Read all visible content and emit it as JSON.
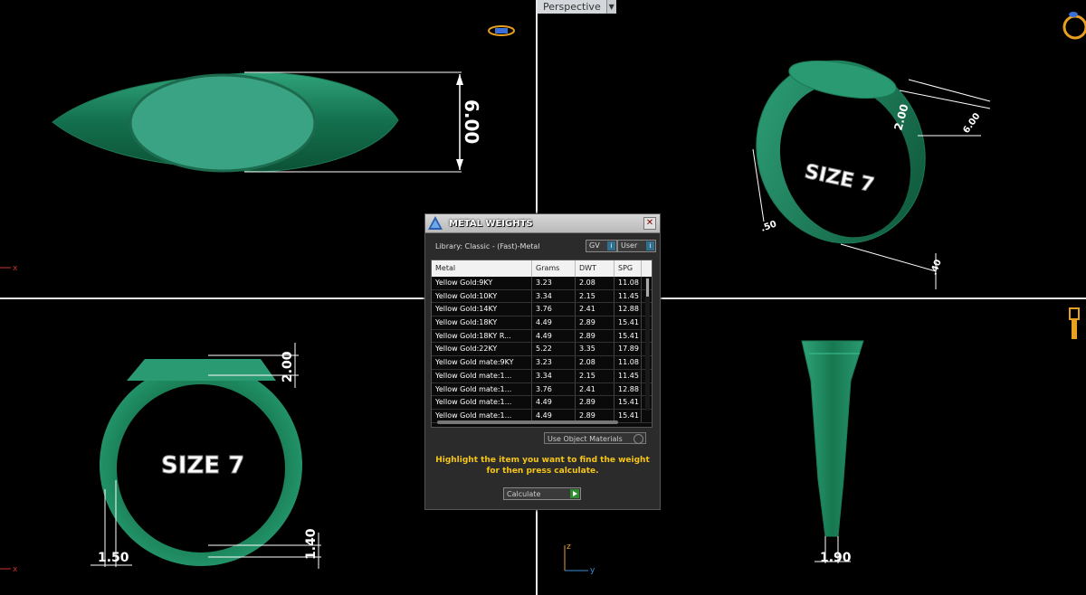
{
  "viewport": {
    "perspective_label": "Perspective",
    "top_left": {
      "dimension": "6.00"
    },
    "top_right": {
      "dim_a": "2.00",
      "dim_b": "6.00",
      "dim_c": ".50",
      "dim_d": ".40",
      "size_text": "SIZE 7"
    },
    "bottom_left": {
      "dim_top": "2.00",
      "dim_bottom": "1.40",
      "dim_left": "1.50",
      "size_text": "SIZE 7"
    },
    "bottom_right": {
      "dimension": "1.90"
    },
    "axis": {
      "x": "x",
      "y": "y",
      "z": "z"
    }
  },
  "dialog": {
    "title": "METAL WEIGHTS",
    "close_label": "✕",
    "library_label": "Library: Classic - (Fast)-Metal",
    "toggle_gv": "GV",
    "toggle_user": "User",
    "columns": [
      "Metal",
      "Grams",
      "DWT",
      "SPG"
    ],
    "rows": [
      [
        "Yellow Gold:9KY",
        "3.23",
        "2.08",
        "11.08"
      ],
      [
        "Yellow Gold:10KY",
        "3.34",
        "2.15",
        "11.45"
      ],
      [
        "Yellow Gold:14KY",
        "3.76",
        "2.41",
        "12.88"
      ],
      [
        "Yellow Gold:18KY",
        "4.49",
        "2.89",
        "15.41"
      ],
      [
        "Yellow Gold:18KY R...",
        "4.49",
        "2.89",
        "15.41"
      ],
      [
        "Yellow Gold:22KY",
        "5.22",
        "3.35",
        "17.89"
      ],
      [
        "Yellow Gold mate:9KY",
        "3.23",
        "2.08",
        "11.08"
      ],
      [
        "Yellow Gold mate:1...",
        "3.34",
        "2.15",
        "11.45"
      ],
      [
        "Yellow Gold mate:1...",
        "3.76",
        "2.41",
        "12.88"
      ],
      [
        "Yellow Gold mate:1...",
        "4.49",
        "2.89",
        "15.41"
      ],
      [
        "Yellow Gold mate:1...",
        "4.49",
        "2.89",
        "15.41"
      ]
    ],
    "use_object_materials": "Use Object Materials",
    "hint": "Highlight the item you want to find the weight for then press calculate.",
    "calculate_label": "Calculate"
  }
}
